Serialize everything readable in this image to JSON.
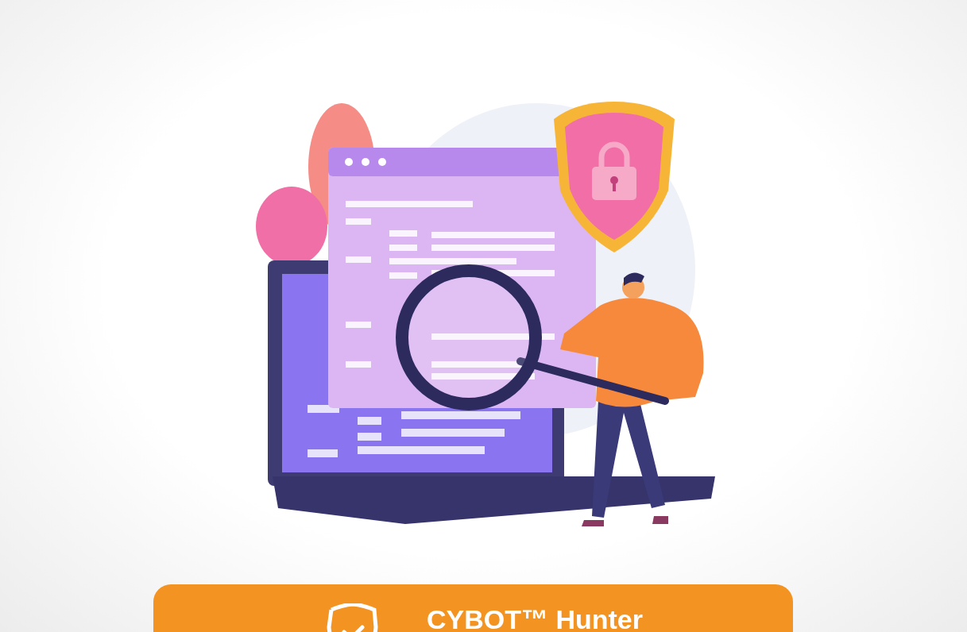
{
  "banner": {
    "title": "CYBOT™ Hunter"
  }
}
